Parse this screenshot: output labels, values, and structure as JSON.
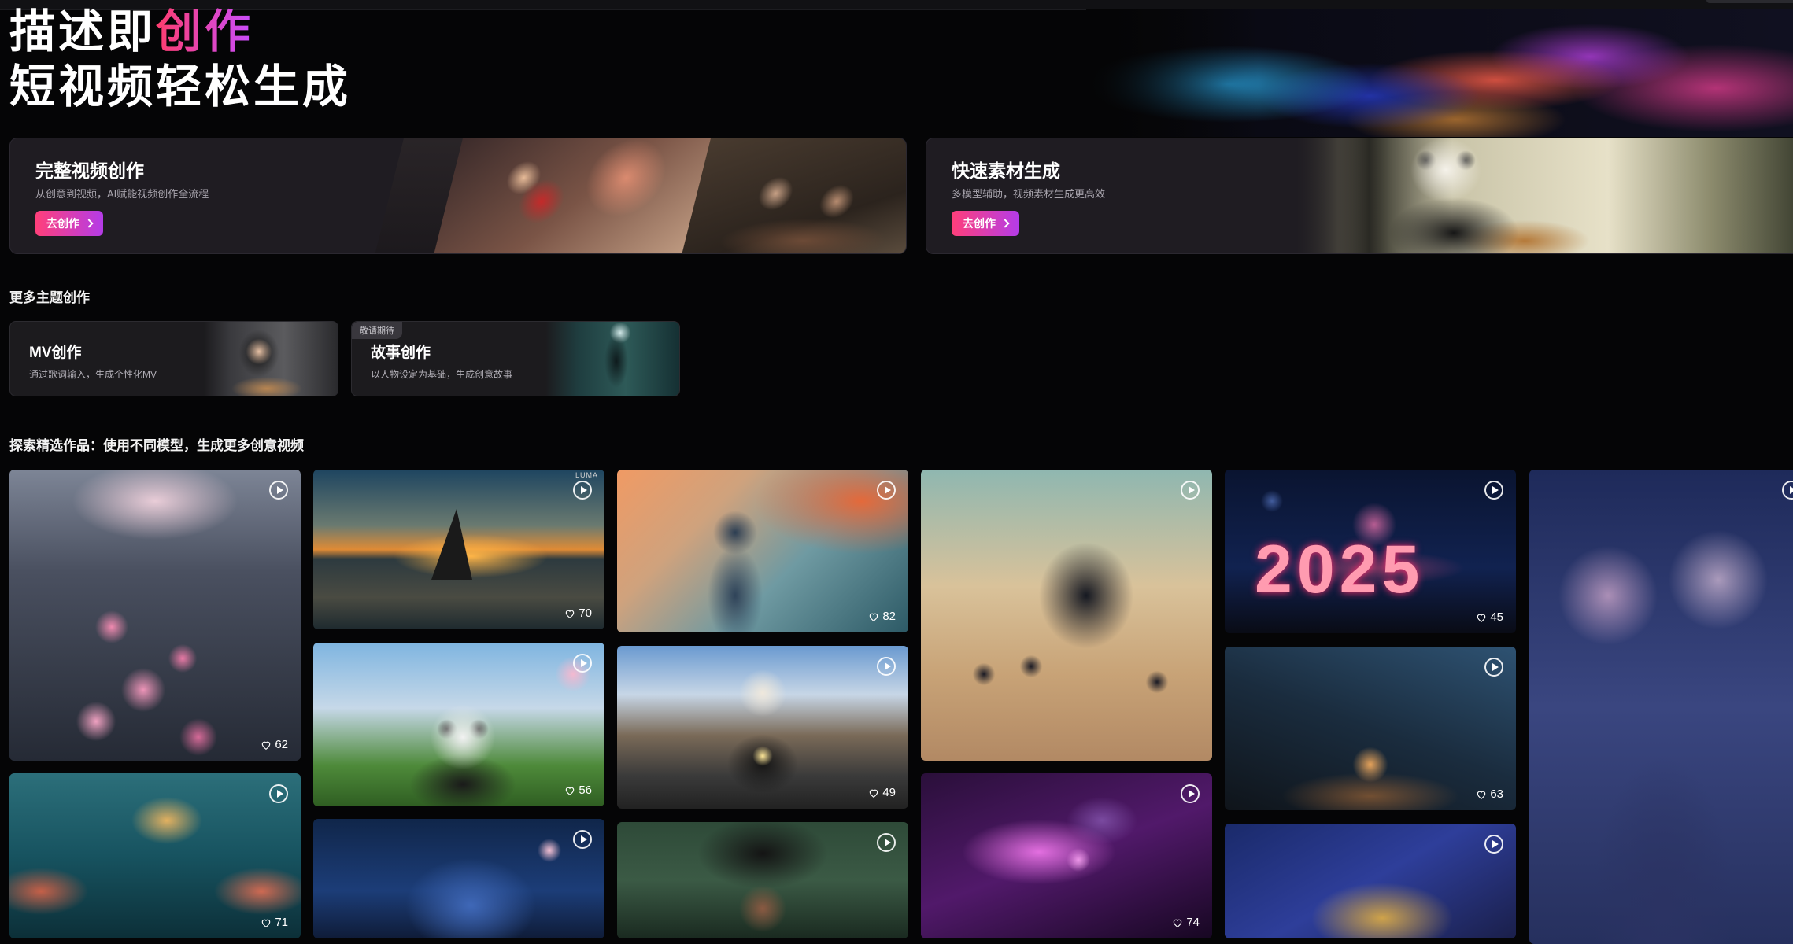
{
  "hero": {
    "title_line1_plain": "描述即",
    "title_line1_accent": "创作",
    "title_line2": "短视频轻松生成"
  },
  "features": [
    {
      "title": "完整视频创作",
      "subtitle": "从创意到视频，AI赋能视频创作全流程",
      "button": "去创作"
    },
    {
      "title": "快速素材生成",
      "subtitle": "多模型辅助，视频素材生成更高效",
      "button": "去创作"
    }
  ],
  "themes_section_title": "更多主题创作",
  "themes": [
    {
      "title": "MV创作",
      "subtitle": "通过歌词输入，生成个性化MV",
      "badge": ""
    },
    {
      "title": "故事创作",
      "subtitle": "以人物设定为基础，生成创意故事",
      "badge": "敬请期待"
    }
  ],
  "gallery_title": "探索精选作品：使用不同模型，生成更多创意视频",
  "gallery": {
    "butterflies": {
      "likes": "62"
    },
    "sailboat": {
      "likes": "70",
      "brand": "LUMA"
    },
    "autumn_girl": {
      "likes": "82"
    },
    "cat_warriors": {
      "likes": ""
    },
    "fireworks_2025": {
      "likes": "45",
      "text": "2025"
    },
    "castle": {
      "likes": ""
    },
    "panda_eiffel": {
      "likes": "56"
    },
    "dog_motorcycle": {
      "likes": "49"
    },
    "glow_butterfly": {
      "likes": "74"
    },
    "hammer_egg": {
      "likes": "63"
    },
    "wizard_hat": {
      "likes": ""
    },
    "mermaid": {
      "likes": "71"
    },
    "mouse_goggles": {
      "likes": ""
    },
    "witch": {
      "likes": ""
    }
  },
  "colors": {
    "accent_start": "#ff3f7a",
    "accent_end": "#b43ce8",
    "background": "#050506",
    "card": "#1f1c22"
  }
}
